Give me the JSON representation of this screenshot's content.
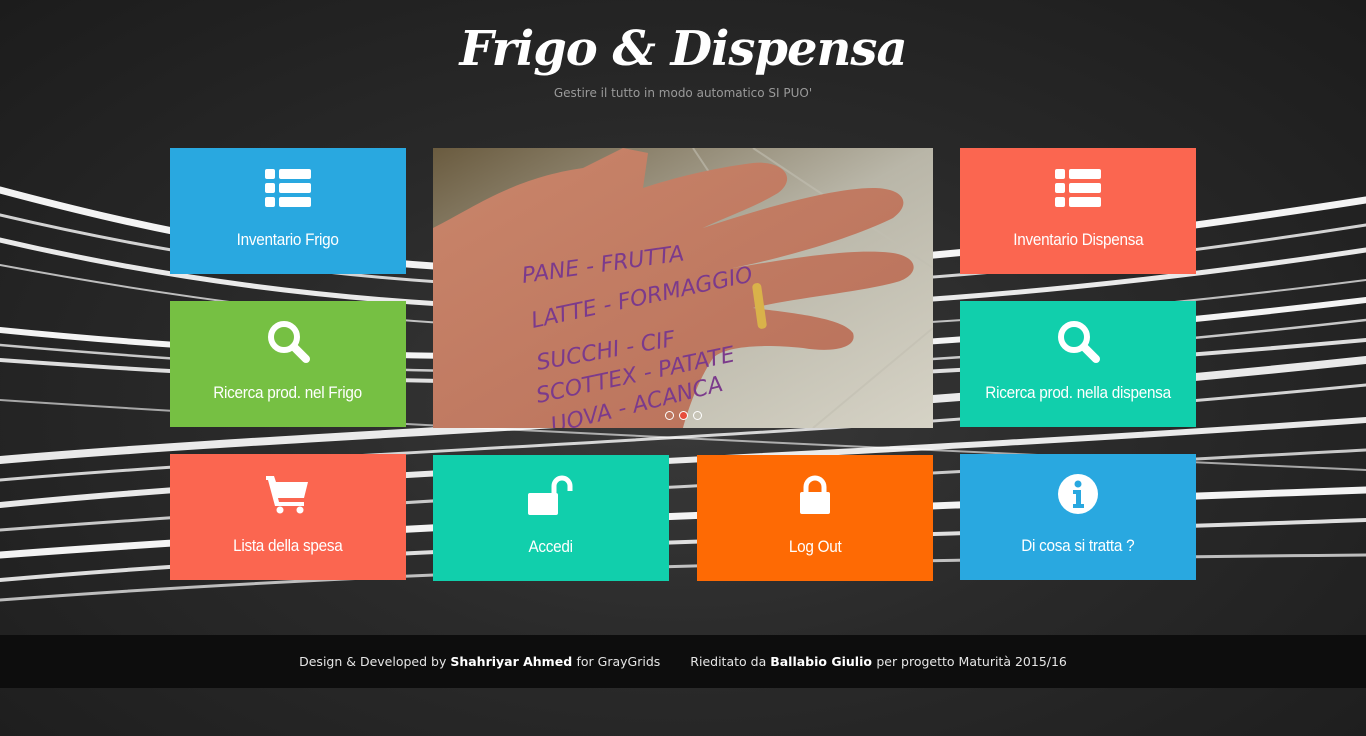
{
  "header": {
    "title": "Frigo & Dispensa",
    "subtitle": "Gestire il tutto in modo automatico SI PUO'"
  },
  "tiles": {
    "inventario_frigo": {
      "label": "Inventario Frigo",
      "icon": "list-icon",
      "color": "#29a8e0"
    },
    "ricerca_frigo": {
      "label": "Ricerca prod. nel Frigo",
      "icon": "search-icon",
      "color": "#76c043"
    },
    "lista_spesa": {
      "label": "Lista della spesa",
      "icon": "cart-icon",
      "color": "#fb6650"
    },
    "accedi": {
      "label": "Accedi",
      "icon": "unlock-icon",
      "color": "#11cfac"
    },
    "logout": {
      "label": "Log Out",
      "icon": "lock-icon",
      "color": "#fe6a04"
    },
    "inventario_dispensa": {
      "label": "Inventario Dispensa",
      "icon": "list-icon",
      "color": "#fb6650"
    },
    "ricerca_dispensa": {
      "label": "Ricerca prod. nella dispensa",
      "icon": "search-icon",
      "color": "#11cfac"
    },
    "info": {
      "label": "Di cosa si tratta ?",
      "icon": "info-icon",
      "color": "#29a8e0"
    }
  },
  "slider": {
    "image": "hand-with-shopping-list-photo",
    "handwriting": [
      "PANE - FRUTTA",
      "LATTE - FORMAGGIO",
      "SUCCHI - CIF",
      "SCOTTEX - PATATE",
      "UOVA - ACANCA"
    ],
    "slide_count": 3,
    "active_slide": 2
  },
  "footer": {
    "design_prefix": "Design & Developed by",
    "design_author": "Shahriyar Ahmed",
    "design_suffix": "for GrayGrids",
    "edit_prefix": "Rieditato da",
    "edit_author": "Ballabio Giulio",
    "edit_suffix": "per progetto Maturità 2015/16"
  }
}
